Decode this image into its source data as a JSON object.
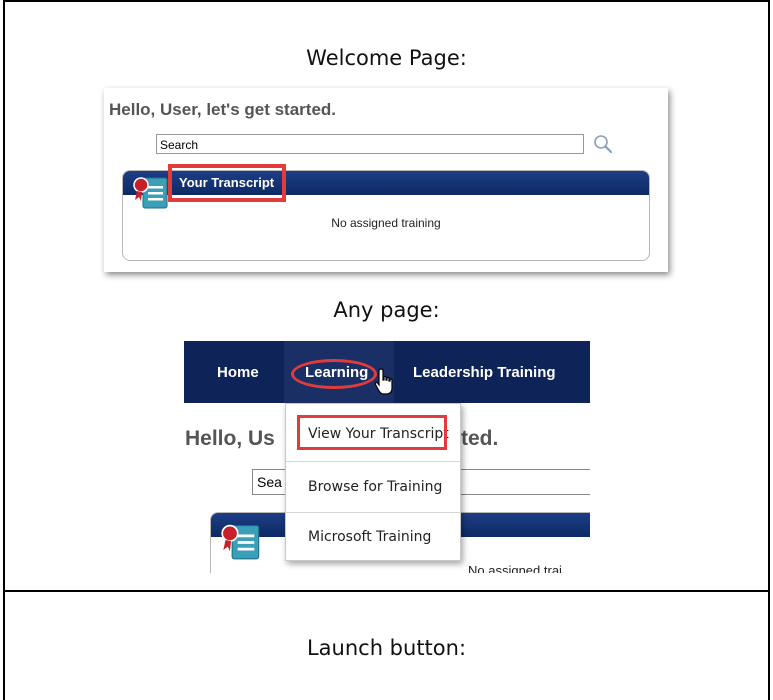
{
  "captions": {
    "welcome": "Welcome Page:",
    "any_page": "Any page:",
    "launch": "Launch button:"
  },
  "welcome_shot": {
    "greeting": "Hello, User, let's get started.",
    "search_value": "Search",
    "search_icon": "magnifier-icon",
    "panel_title": "Your Transcript",
    "panel_empty_text": "No assigned training",
    "transcript_icon": "transcript-certificate-icon",
    "highlight_color": "#e23b3b"
  },
  "any_page_shot": {
    "nav": {
      "home": "Home",
      "learning": "Learning",
      "leadership": "Leadership Training"
    },
    "greeting_left": "Hello, Us",
    "greeting_right": "ted.",
    "search_value": "Sea",
    "menu": {
      "view_transcript": "View Your Transcript",
      "browse": "Browse for Training",
      "microsoft": "Microsoft Training"
    },
    "partial_text": "No assigned trai",
    "cursor_icon": "hand-pointer-icon",
    "nav_color": "#0e2458",
    "highlight_color": "#e23b3b"
  }
}
